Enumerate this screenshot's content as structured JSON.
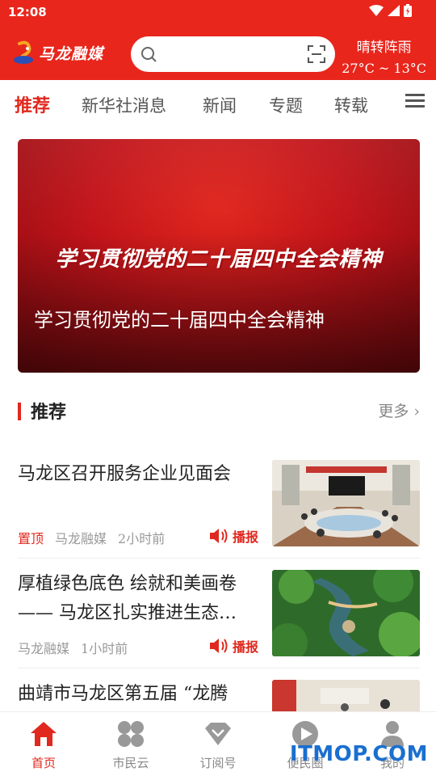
{
  "status": {
    "time": "12:08"
  },
  "header": {
    "logo_text": "马龙融媒",
    "search_placeholder": "",
    "weather": {
      "condition": "晴转阵雨",
      "temp": "27°C ~ 13°C"
    }
  },
  "tabs": [
    {
      "label": "推荐",
      "active": true
    },
    {
      "label": "新华社消息"
    },
    {
      "label": "新闻"
    },
    {
      "label": "专题"
    },
    {
      "label": "转载"
    }
  ],
  "banner": {
    "art_text": "学习贯彻党的二十届四中全会精神",
    "caption": "学习贯彻党的二十届四中全会精神"
  },
  "section": {
    "title": "推荐",
    "more": "更多"
  },
  "news": [
    {
      "headline": "马龙区召开服务企业见面会",
      "pin": "置顶",
      "source": "马龙融媒",
      "time": "2小时前",
      "play": "播报",
      "thumb": "meeting-room"
    },
    {
      "headline": "厚植绿色底色 绘就和美画卷 —— 马龙区扎实推进生态…",
      "source": "马龙融媒",
      "time": "1小时前",
      "play": "播报",
      "thumb": "green-park-aerial"
    },
    {
      "headline": "曲靖市马龙区第五届 “龙腾",
      "thumb": "gym-event"
    }
  ],
  "bottom_nav": [
    {
      "label": "首页",
      "icon": "home-icon",
      "active": true
    },
    {
      "label": "市民云",
      "icon": "clover-icon"
    },
    {
      "label": "订阅号",
      "icon": "diamond-icon"
    },
    {
      "label": "便民圈",
      "icon": "circle-play-icon"
    },
    {
      "label": "我的",
      "icon": "person-icon"
    }
  ],
  "watermark": "ITMOP.COM",
  "colors": {
    "brand_red": "#e8261c",
    "accent_red": "#e0281e"
  }
}
